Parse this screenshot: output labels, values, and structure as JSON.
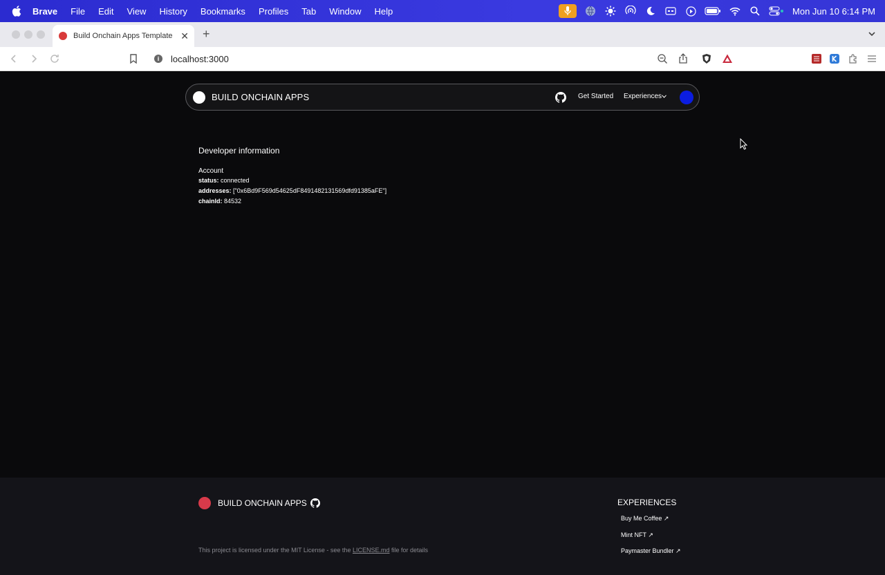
{
  "menubar": {
    "app": "Brave",
    "items": [
      "File",
      "Edit",
      "View",
      "History",
      "Bookmarks",
      "Profiles",
      "Tab",
      "Window",
      "Help"
    ],
    "clock": "Mon Jun 10  6:14 PM"
  },
  "browser": {
    "tab_title": "Build Onchain Apps Template",
    "url": "localhost:3000"
  },
  "nav": {
    "brand": "BUILD ONCHAIN APPS",
    "get_started": "Get Started",
    "experiences": "Experiences"
  },
  "dev": {
    "heading": "Developer information",
    "account_label": "Account",
    "status_key": "status:",
    "status_val": "connected",
    "addresses_key": "addresses:",
    "addresses_val": "[\"0x6Bd9F569d54625dF8491482131569dfd91385aFE\"]",
    "chain_key": "chainId:",
    "chain_val": "84532"
  },
  "footer": {
    "brand": "BUILD ONCHAIN APPS",
    "license_pre": "This project is licensed under the MIT License - see the",
    "license_link": "LICENSE.md",
    "license_post": "file for details",
    "experiences_heading": "EXPERIENCES",
    "links": [
      "Buy Me Coffee ↗",
      "Mint NFT ↗",
      "Paymaster Bundler ↗"
    ]
  },
  "colors": {
    "menubar": "#3535d6",
    "page_bg": "#0a0a0c",
    "footer_bg": "#141419",
    "wallet": "#0b1de0",
    "footer_logo": "#d83a4a"
  }
}
